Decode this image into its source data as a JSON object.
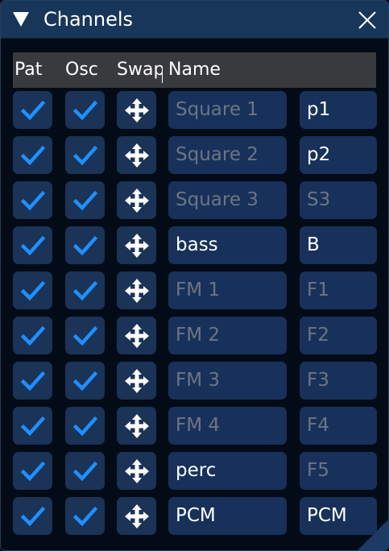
{
  "window": {
    "title": "Channels"
  },
  "header": {
    "pat": "Pat",
    "osc": "Osc",
    "swap": "Swap",
    "name": "Name"
  },
  "colors": {
    "accent": "#1e90ff",
    "field_bg": "#17315a",
    "dim_text": "#6d7584",
    "title_bar": "#17365a"
  },
  "channels": [
    {
      "pat": true,
      "osc": true,
      "name": "",
      "name_placeholder": "Square 1",
      "short": "p1",
      "short_placeholder": ""
    },
    {
      "pat": true,
      "osc": true,
      "name": "",
      "name_placeholder": "Square 2",
      "short": "p2",
      "short_placeholder": ""
    },
    {
      "pat": true,
      "osc": true,
      "name": "",
      "name_placeholder": "Square 3",
      "short": "",
      "short_placeholder": "S3"
    },
    {
      "pat": true,
      "osc": true,
      "name": "bass",
      "name_placeholder": "",
      "short": "B",
      "short_placeholder": ""
    },
    {
      "pat": true,
      "osc": true,
      "name": "",
      "name_placeholder": "FM 1",
      "short": "",
      "short_placeholder": "F1"
    },
    {
      "pat": true,
      "osc": true,
      "name": "",
      "name_placeholder": "FM 2",
      "short": "",
      "short_placeholder": "F2"
    },
    {
      "pat": true,
      "osc": true,
      "name": "",
      "name_placeholder": "FM 3",
      "short": "",
      "short_placeholder": "F3"
    },
    {
      "pat": true,
      "osc": true,
      "name": "",
      "name_placeholder": "FM 4",
      "short": "",
      "short_placeholder": "F4"
    },
    {
      "pat": true,
      "osc": true,
      "name": "perc",
      "name_placeholder": "",
      "short": "",
      "short_placeholder": "F5"
    },
    {
      "pat": true,
      "osc": true,
      "name": "PCM",
      "name_placeholder": "",
      "short": "PCM",
      "short_placeholder": ""
    }
  ]
}
